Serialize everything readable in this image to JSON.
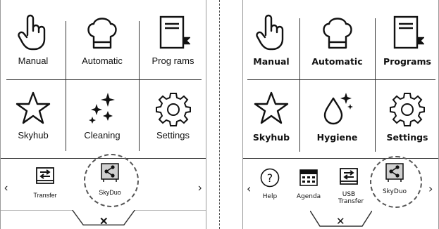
{
  "left_panel": {
    "tiles": [
      {
        "label": "Manual",
        "icon": "hand-pointer-icon"
      },
      {
        "label": "Automatic",
        "icon": "chef-hat-icon"
      },
      {
        "label": "Prog rams",
        "icon": "recipe-book-icon"
      },
      {
        "label": "Skyhub",
        "icon": "star-icon"
      },
      {
        "label": "Cleaning",
        "icon": "sparkles-icon"
      },
      {
        "label": "Settings",
        "icon": "gear-icon"
      }
    ],
    "tray": [
      {
        "label": "Transfer",
        "icon": "transfer-icon"
      },
      {
        "label": "SkyDuo",
        "icon": "share-icon",
        "highlighted": true
      }
    ],
    "prev": "‹",
    "next": "›",
    "close": "✕"
  },
  "right_panel": {
    "tiles": [
      {
        "label": "Manual",
        "icon": "hand-pointer-icon"
      },
      {
        "label": "Automatic",
        "icon": "chef-hat-icon"
      },
      {
        "label": "Programs",
        "icon": "recipe-book-icon"
      },
      {
        "label": "Skyhub",
        "icon": "star-icon"
      },
      {
        "label": "Hygiene",
        "icon": "water-drop-sparkle-icon"
      },
      {
        "label": "Settings",
        "icon": "gear-icon"
      }
    ],
    "tray": [
      {
        "label": "Help",
        "icon": "question-icon"
      },
      {
        "label": "Agenda",
        "icon": "calendar-icon"
      },
      {
        "label": "USB Transfer",
        "icon": "transfer-icon"
      },
      {
        "label": "SkyDuo",
        "icon": "share-icon",
        "highlighted": true
      }
    ],
    "prev": "‹",
    "next": "›",
    "close": "✕"
  }
}
